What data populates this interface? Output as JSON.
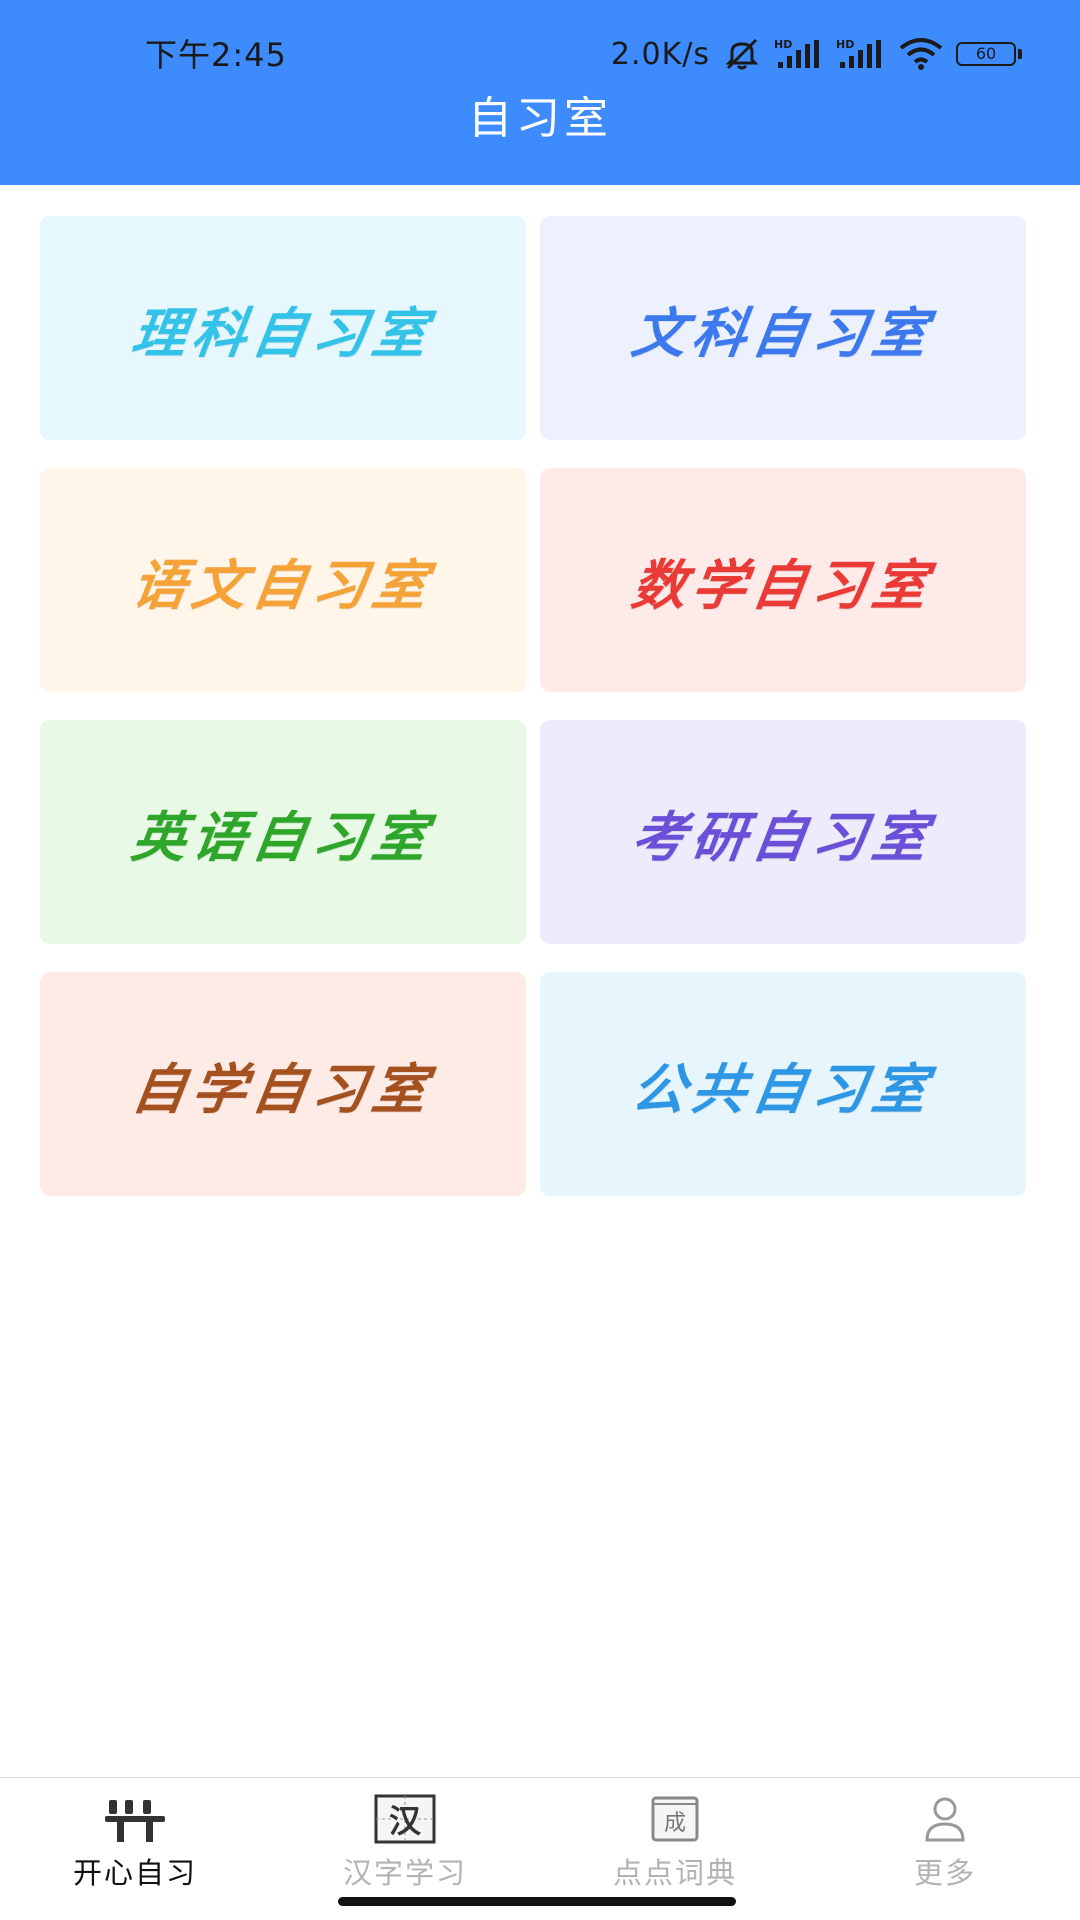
{
  "status_bar": {
    "time": "下午2:45",
    "net_speed": "2.0K/s",
    "battery": "60",
    "hd_label_1": "HD",
    "hd_label_2": "HD"
  },
  "header": {
    "title": "自习室",
    "background": "#3d8bfd"
  },
  "rooms": [
    {
      "label": "理科自习室",
      "bg": "#e6f8fd",
      "color": "#33c3e8"
    },
    {
      "label": "文科自习室",
      "bg": "#ecf1fd",
      "color": "#3c78ee"
    },
    {
      "label": "语文自习室",
      "bg": "#fff5e9",
      "color": "#f5a236"
    },
    {
      "label": "数学自习室",
      "bg": "#ffeaea",
      "color": "#ea3a35"
    },
    {
      "label": "英语自习室",
      "bg": "#e8fae6",
      "color": "#2ea629"
    },
    {
      "label": "考研自习室",
      "bg": "#eeebfd",
      "color": "#6a4fd8"
    },
    {
      "label": "自学自习室",
      "bg": "#ffebe6",
      "color": "#a4501f"
    },
    {
      "label": "公共自习室",
      "bg": "#e7f6fd",
      "color": "#2d97e5"
    }
  ],
  "bottom_nav": {
    "items": [
      {
        "label": "开心自习",
        "icon": "happy-study-icon",
        "active": true
      },
      {
        "label": "汉字学习",
        "icon": "hanzi-icon",
        "icon_text": "汉",
        "active": false
      },
      {
        "label": "点点词典",
        "icon": "idiom-dictionary-icon",
        "icon_text": "成",
        "active": false
      },
      {
        "label": "更多",
        "icon": "user-icon",
        "active": false
      }
    ]
  }
}
